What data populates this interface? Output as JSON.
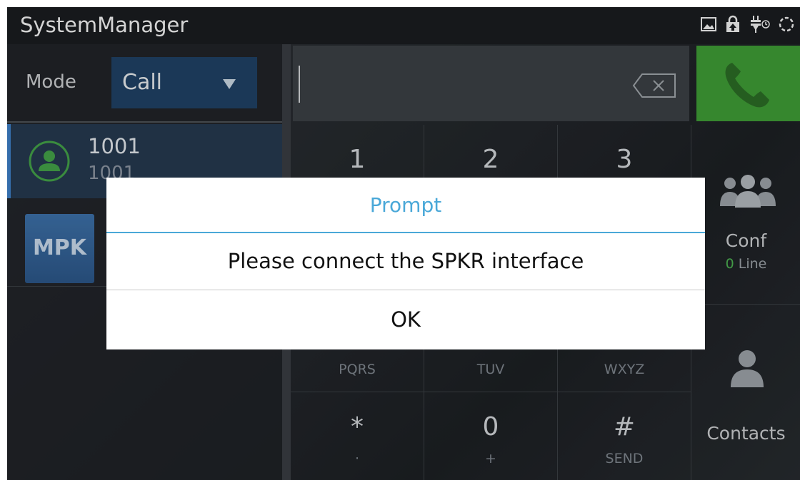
{
  "app": {
    "title": "SystemManager"
  },
  "status_icons": [
    "image-icon",
    "lock-upload-icon",
    "power-plug-icon",
    "sync-icon"
  ],
  "mode": {
    "label": "Mode",
    "value": "Call"
  },
  "account": {
    "name": "1001",
    "number": "1001"
  },
  "mpk": {
    "label": "MPK"
  },
  "dialpad": {
    "keys": [
      {
        "digit": "1",
        "letters": ""
      },
      {
        "digit": "2",
        "letters": ""
      },
      {
        "digit": "3",
        "letters": ""
      },
      {
        "digit": "",
        "letters": "PQRS"
      },
      {
        "digit": "",
        "letters": "TUV"
      },
      {
        "digit": "",
        "letters": "WXYZ"
      },
      {
        "digit": "*",
        "letters": "·"
      },
      {
        "digit": "0",
        "letters": "+"
      },
      {
        "digit": "#",
        "letters": "SEND"
      }
    ]
  },
  "conf": {
    "label": "Conf",
    "line_count": "0",
    "line_label": "Line"
  },
  "contacts": {
    "label": "Contacts"
  },
  "dialog": {
    "title": "Prompt",
    "message": "Please connect the SPKR interface",
    "ok": "OK"
  },
  "colors": {
    "call_green": "#3e9a35",
    "dialog_accent": "#4aa8d8",
    "selected_account": "#25384e",
    "mode_select_bg": "#1f4064"
  }
}
